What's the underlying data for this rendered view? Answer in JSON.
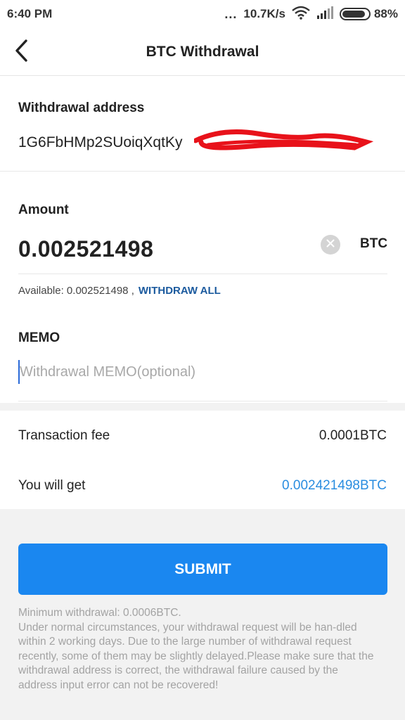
{
  "status_bar": {
    "time": "6:40 PM",
    "dots": "...",
    "network_speed": "10.7K/s",
    "battery_percent": "88%",
    "battery_level": 0.88
  },
  "header": {
    "title": "BTC Withdrawal",
    "back_icon": "chevron-left-icon"
  },
  "withdrawal_address": {
    "label": "Withdrawal address",
    "value": "1G6FbHMp2SUoiqXqtKy"
  },
  "amount": {
    "label": "Amount",
    "value": "0.002521498",
    "currency": "BTC",
    "clear_icon": "clear-icon",
    "available_text": "Available: 0.002521498 ,",
    "withdraw_all_label": "WITHDRAW ALL"
  },
  "memo": {
    "label": "MEMO",
    "placeholder": "Withdrawal MEMO(optional)"
  },
  "fees": {
    "fee_label": "Transaction fee",
    "fee_value": "0.0001BTC",
    "get_label": "You will get",
    "get_value": "0.002421498BTC"
  },
  "submit_label": "SUBMIT",
  "notes": {
    "minimum": "Minimum withdrawal: 0.0006BTC.",
    "body": "Under normal circumstances, your withdrawal request will be han-dled within 2 working days. Due to the large number of withdrawal request recently, some of them may be slightly delayed.Please make sure that the withdrawal address is correct, the withdrawal failure caused by the address input error can not be recovered!"
  },
  "colors": {
    "accent": "#1a87f0",
    "link": "#1b5a9e",
    "receive": "#2a8de0",
    "redaction": "#e8121a"
  }
}
